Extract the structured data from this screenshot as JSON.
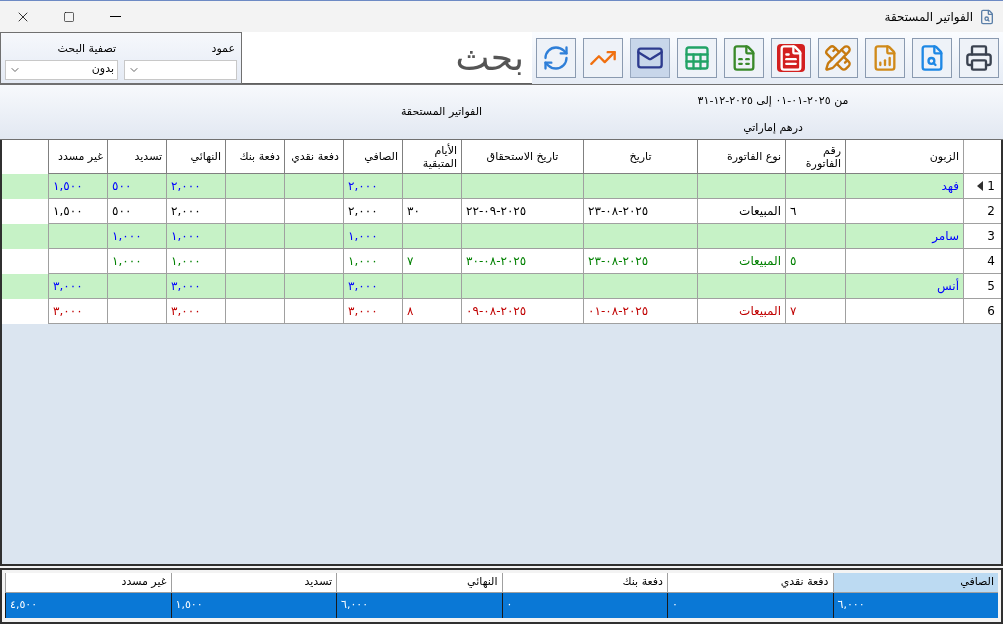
{
  "window": {
    "title": "الفواتير المستحقة"
  },
  "toolbar": {
    "buttons": [
      {
        "kind": "print",
        "selected": false
      },
      {
        "kind": "preview",
        "selected": false
      },
      {
        "kind": "design",
        "selected": false
      },
      {
        "kind": "tools",
        "selected": false
      },
      {
        "kind": "pdf",
        "selected": false
      },
      {
        "kind": "csv",
        "selected": false
      },
      {
        "kind": "excel",
        "selected": false
      },
      {
        "kind": "email",
        "selected": true
      },
      {
        "kind": "chart",
        "selected": false
      },
      {
        "kind": "refresh",
        "selected": false
      }
    ],
    "search": {
      "placeholder": "بحث"
    },
    "filters": [
      {
        "label": "عمود"
      },
      {
        "label": "تصفية البحث",
        "value": "بدون"
      }
    ]
  },
  "report_header": {
    "title": "الفواتير المستحقة",
    "period": "من ٢٠٢٥-٠١-٠١ إلى ٢٠٢٥-١٢-٣١",
    "currency": "درهم إماراتي"
  },
  "table": {
    "columns": [
      "الزبون",
      "رقم الفاتورة",
      "نوع الفاتورة",
      "تاريخ",
      "تاريخ الاستحقاق",
      "الأيام المتبقية",
      "الصافي",
      "دفعة نقدي",
      "دفعة بنك",
      "النهائي",
      "تسديد",
      "غير مسدد"
    ],
    "rows": [
      {
        "number": "1",
        "kind": "group",
        "selected": true,
        "color": "#0000ff",
        "cells": {
          "customer": "فهد",
          "net": "٢,٠٠٠",
          "final": "٢,٠٠٠",
          "paid": "٥٠٠",
          "unpaid": "١,٥٠٠"
        }
      },
      {
        "number": "2",
        "kind": "invoice",
        "selected": false,
        "color": "#000000",
        "cells": {
          "invoice_no": "٦",
          "invoice_type": "المبيعات",
          "date": "٢٠٢٥-٠٨-٢٣",
          "due_date": "٢٠٢٥-٠٩-٢٢",
          "days_left": "٣٠",
          "net": "٢,٠٠٠",
          "final": "٢,٠٠٠",
          "paid": "٥٠٠",
          "unpaid": "١,٥٠٠"
        }
      },
      {
        "number": "3",
        "kind": "group",
        "selected": false,
        "color": "#0000ff",
        "cells": {
          "customer": "سامر",
          "net": "١,٠٠٠",
          "final": "١,٠٠٠",
          "paid": "١,٠٠٠"
        }
      },
      {
        "number": "4",
        "kind": "invoice",
        "selected": false,
        "color": "#008000",
        "cells": {
          "invoice_no": "٥",
          "invoice_type": "المبيعات",
          "date": "٢٠٢٥-٠٨-٢٣",
          "due_date": "٢٠٢٥-٠٨-٣٠",
          "days_left": "٧",
          "net": "١,٠٠٠",
          "final": "١,٠٠٠",
          "paid": "١,٠٠٠"
        }
      },
      {
        "number": "5",
        "kind": "group",
        "selected": false,
        "color": "#0000ff",
        "cells": {
          "customer": "أنس",
          "net": "٣,٠٠٠",
          "final": "٣,٠٠٠",
          "unpaid": "٣,٠٠٠"
        }
      },
      {
        "number": "6",
        "kind": "invoice",
        "selected": false,
        "color": "#c00000",
        "cells": {
          "invoice_no": "٧",
          "invoice_type": "المبيعات",
          "date": "٢٠٢٥-٠٨-٠١",
          "due_date": "٢٠٢٥-٠٨-٠٩",
          "days_left": "٨",
          "net": "٣,٠٠٠",
          "final": "٣,٠٠٠",
          "unpaid": "٣,٠٠٠"
        }
      }
    ]
  },
  "totals": {
    "columns": [
      {
        "label": "الصافي",
        "selected": true
      },
      {
        "label": "دفعة نقدي",
        "selected": false
      },
      {
        "label": "دفعة بنك",
        "selected": false
      },
      {
        "label": "النهائي",
        "selected": false
      },
      {
        "label": "تسديد",
        "selected": false
      },
      {
        "label": "غير مسدد",
        "selected": false
      }
    ],
    "row": {
      "selected": true,
      "values": [
        "٦,٠٠٠",
        "٠",
        "٠",
        "٦,٠٠٠",
        "١,٥٠٠",
        "٤,٥٠٠"
      ]
    }
  }
}
